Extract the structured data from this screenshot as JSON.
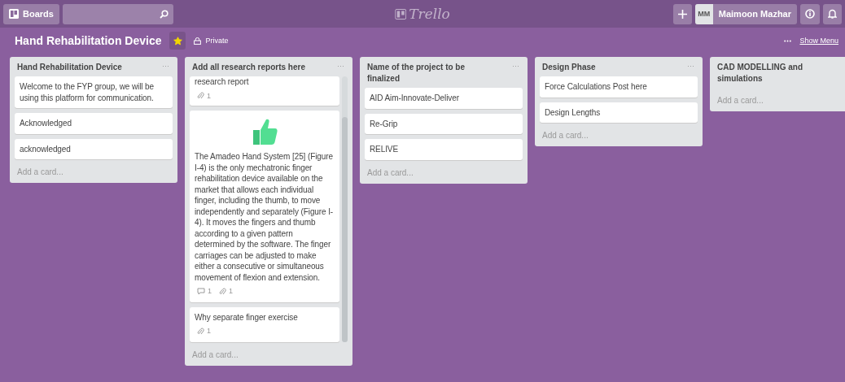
{
  "header": {
    "boards_label": "Boards",
    "logo": "Trello",
    "user": {
      "initials": "MM",
      "name": "Maimoon Mazhar"
    }
  },
  "board": {
    "title": "Hand Rehabilitation Device",
    "starred": true,
    "visibility": "Private",
    "menu_label": "Show Menu"
  },
  "lists": [
    {
      "title": "Hand Rehabilitation Device",
      "menu": "···",
      "cards": [
        {
          "text": "Welcome to the FYP group, we will be using this platform for communication."
        },
        {
          "text": "Acknowledged"
        },
        {
          "text": "acknowledged"
        }
      ],
      "add_label": "Add a card..."
    },
    {
      "title": "Add all research reports here",
      "menu": "···",
      "scrolled": true,
      "cards": [
        {
          "sticker": false,
          "text": "research report",
          "badges": [
            {
              "kind": "attachment",
              "count": "1"
            }
          ]
        },
        {
          "sticker": true,
          "text": "The Amadeo Hand System [25] (Figure I-4) is the only mechatronic finger rehabilitation device available on the market that allows each individual finger, including the thumb, to move independently and separately (Figure I-4). It moves the fingers and thumb according to a given pattern determined by the software. The finger carriages can be adjusted to make either a consecutive or simultaneous movement of flexion and extension.",
          "badges": [
            {
              "kind": "comment",
              "count": "1"
            },
            {
              "kind": "attachment",
              "count": "1"
            }
          ]
        },
        {
          "sticker": false,
          "text": "Why separate finger exercise",
          "badges": [
            {
              "kind": "attachment",
              "count": "1"
            }
          ]
        }
      ],
      "add_label": "Add a card..."
    },
    {
      "title": "Name of the project to be finalized",
      "menu": "···",
      "cards": [
        {
          "text": "AID Aim-Innovate-Deliver"
        },
        {
          "text": "Re-Grip"
        },
        {
          "text": "RELIVE"
        }
      ],
      "add_label": "Add a card..."
    },
    {
      "title": "Design Phase",
      "menu": "···",
      "cards": [
        {
          "text": "Force Calculations Post here"
        },
        {
          "text": "Design Lengths"
        }
      ],
      "add_label": "Add a card..."
    },
    {
      "title": "CAD MODELLING and simulations",
      "add_label": "Add a card..."
    }
  ]
}
